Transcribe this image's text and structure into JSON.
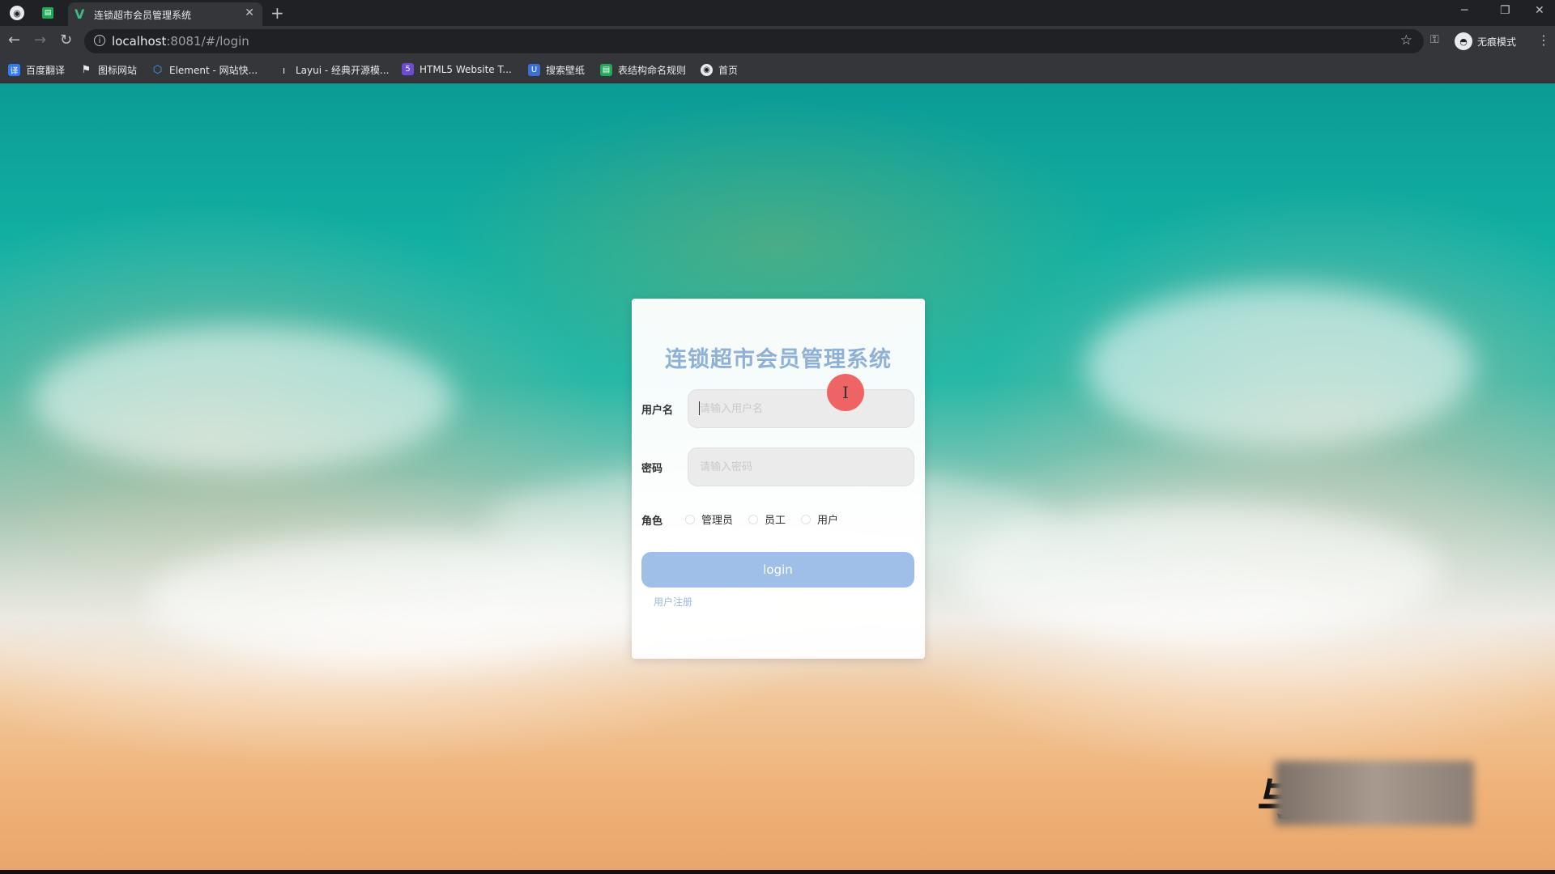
{
  "browser": {
    "tab_title": "连锁超市会员管理系统",
    "new_tab_glyph": "+",
    "tab_close_glyph": "✕",
    "url_host": "localhost",
    "url_path": ":8081/#/login",
    "incognito_label": "无痕模式",
    "bookmarks": [
      {
        "label": "百度翻译",
        "icon": "translate-icon",
        "color": "#2f7cf6"
      },
      {
        "label": "图标网站",
        "icon": "flag-icon",
        "color": "#e8eaed"
      },
      {
        "label": "Element - 网站快...",
        "icon": "element-icon",
        "color": "#409eff"
      },
      {
        "label": "Layui - 经典开源模...",
        "icon": "layui-icon",
        "color": "#e8eaed"
      },
      {
        "label": "HTML5 Website T...",
        "icon": "html5-icon",
        "color": "#6c4bd8"
      },
      {
        "label": "搜索壁纸",
        "icon": "wallpaper-icon",
        "color": "#3b6fd6"
      },
      {
        "label": "表结构命名规则",
        "icon": "sheet-icon",
        "color": "#1faa59"
      },
      {
        "label": "首页",
        "icon": "globe-icon",
        "color": "#e8eaed"
      }
    ]
  },
  "login": {
    "title": "连锁超市会员管理系统",
    "username_label": "用户名",
    "username_placeholder": "请输入用户名",
    "password_label": "密码",
    "password_placeholder": "请输入密码",
    "role_label": "角色",
    "roles": [
      "管理员",
      "员工",
      "用户"
    ],
    "login_button": "login",
    "register_link": "用户注册"
  },
  "colors": {
    "title": "#8fb0d8",
    "button": "#a0bfe8",
    "link": "#9cb9e0",
    "cursor": "#ee5050"
  }
}
